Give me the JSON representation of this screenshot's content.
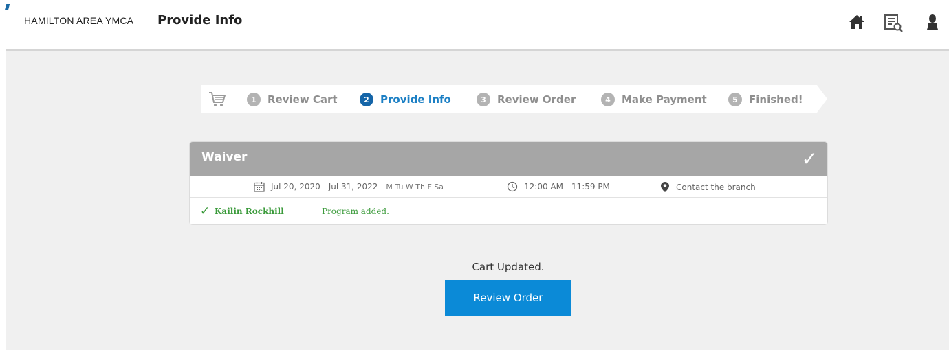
{
  "header": {
    "org_name": "HAMILTON AREA YMCA",
    "page_title": "Provide Info",
    "icons": [
      "home-icon",
      "search-list-icon",
      "user-icon"
    ]
  },
  "steps": [
    {
      "number": "1",
      "label": "Review Cart",
      "active": false
    },
    {
      "number": "2",
      "label": "Provide Info",
      "active": true
    },
    {
      "number": "3",
      "label": "Review Order",
      "active": false
    },
    {
      "number": "4",
      "label": "Make Payment",
      "active": false
    },
    {
      "number": "5",
      "label": "Finished!",
      "active": false
    }
  ],
  "program": {
    "title": "Waiver",
    "date_range": "Jul 20, 2020 - Jul 31, 2022",
    "days": "M Tu W Th F Sa",
    "time": "12:00 AM - 11:59 PM",
    "location": "Contact the branch",
    "participant": "Kailin Rockhill",
    "status": "Program added."
  },
  "cart_status": "Cart Updated.",
  "review_button": "Review Order",
  "colors": {
    "accent": "#0b8ad7",
    "active_step": "#1565a8",
    "success": "#3a9a3a",
    "card_header": "#a6a6a6"
  }
}
